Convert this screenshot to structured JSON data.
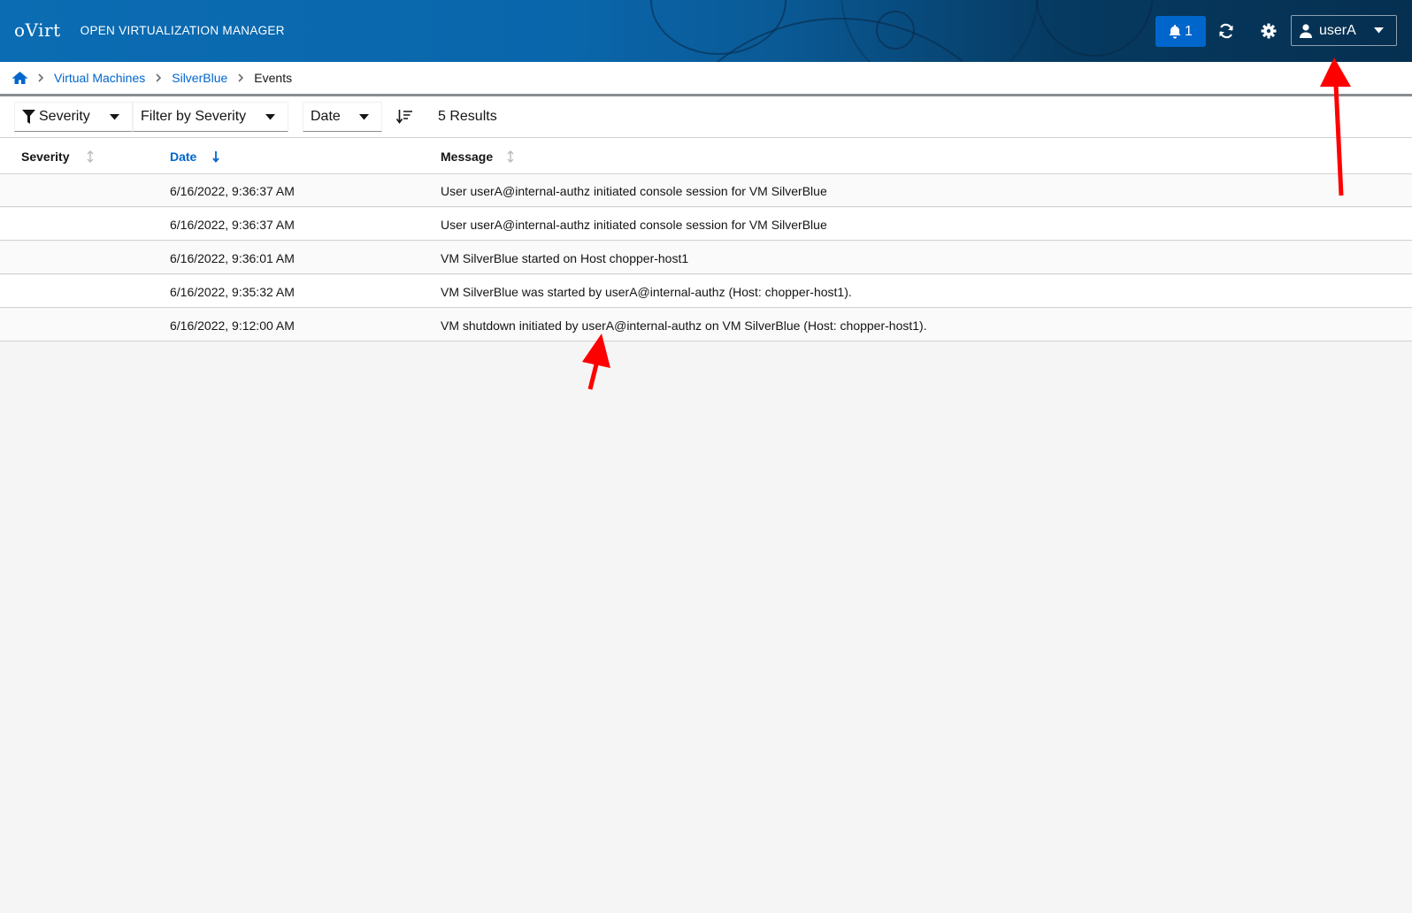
{
  "header": {
    "logo": "oVirt",
    "product_name": "OPEN VIRTUALIZATION MANAGER",
    "notification_count": "1",
    "user_name": "userA",
    "icons": [
      "bell-icon",
      "refresh-icon",
      "gear-icon",
      "user-icon",
      "caret-down-icon"
    ],
    "colors": {
      "masthead": "#0b6cb3",
      "notification_button": "#0066cc"
    }
  },
  "breadcrumb": {
    "items": [
      "Virtual Machines",
      "SilverBlue"
    ],
    "current": "Events"
  },
  "toolbar": {
    "filter_attribute": "Severity",
    "filter_value_placeholder": "Filter by Severity",
    "sort_field": "Date",
    "results": "5 Results"
  },
  "table": {
    "columns": [
      {
        "label": "Severity",
        "sort": "none"
      },
      {
        "label": "Date",
        "sort": "descending"
      },
      {
        "label": "Message",
        "sort": "none"
      }
    ],
    "rows": [
      {
        "severity": "",
        "date": "6/16/2022, 9:36:37 AM",
        "message": "User userA@internal-authz initiated console session for VM SilverBlue"
      },
      {
        "severity": "",
        "date": "6/16/2022, 9:36:37 AM",
        "message": "User userA@internal-authz initiated console session for VM SilverBlue"
      },
      {
        "severity": "",
        "date": "6/16/2022, 9:36:01 AM",
        "message": "VM SilverBlue started on Host chopper-host1"
      },
      {
        "severity": "",
        "date": "6/16/2022, 9:35:32 AM",
        "message": "VM SilverBlue was started by userA@internal-authz (Host: chopper-host1)."
      },
      {
        "severity": "",
        "date": "6/16/2022, 9:12:00 AM",
        "message": "VM shutdown initiated by userA@internal-authz on VM SilverBlue (Host: chopper-host1)."
      }
    ]
  },
  "annotations": {
    "arrow_color": "#ff0000"
  }
}
